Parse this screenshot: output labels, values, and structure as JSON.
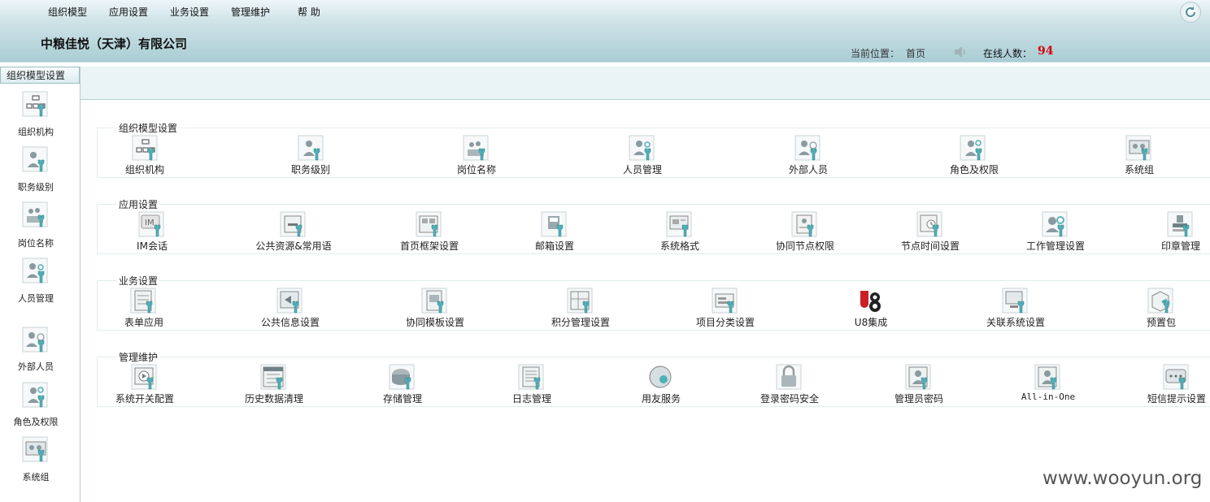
{
  "top_menu": [
    "组织模型",
    "应用设置",
    "业务设置",
    "管理维护",
    "帮 助"
  ],
  "company": "中粮佳悦（天津）有限公司",
  "location_label": "当前位置：",
  "location_value": "首页",
  "online_label": "在线人数：",
  "online_count": "94",
  "sidebar": {
    "title": "组织模型设置",
    "items": [
      {
        "label": "组织机构",
        "icon": "org-structure-icon"
      },
      {
        "label": "职务级别",
        "icon": "job-level-icon"
      },
      {
        "label": "岗位名称",
        "icon": "position-name-icon"
      },
      {
        "label": "人员管理",
        "icon": "personnel-icon"
      },
      {
        "label": "外部人员",
        "icon": "external-person-icon"
      },
      {
        "label": "角色及权限",
        "icon": "role-permission-icon"
      },
      {
        "label": "系统组",
        "icon": "system-group-icon"
      }
    ]
  },
  "sections": [
    {
      "title": "组织模型设置",
      "items": [
        {
          "label": "组织机构",
          "icon": "org-structure-icon"
        },
        {
          "label": "职务级别",
          "icon": "job-level-icon"
        },
        {
          "label": "岗位名称",
          "icon": "position-name-icon"
        },
        {
          "label": "人员管理",
          "icon": "personnel-icon"
        },
        {
          "label": "外部人员",
          "icon": "external-person-icon"
        },
        {
          "label": "角色及权限",
          "icon": "role-permission-icon"
        },
        {
          "label": "系统组",
          "icon": "system-group-icon"
        }
      ]
    },
    {
      "title": "应用设置",
      "items": [
        {
          "label": "IM会话",
          "icon": "im-chat-icon"
        },
        {
          "label": "公共资源&常用语",
          "icon": "public-resource-icon"
        },
        {
          "label": "首页框架设置",
          "icon": "homepage-frame-icon"
        },
        {
          "label": "邮箱设置",
          "icon": "mailbox-icon"
        },
        {
          "label": "系统格式",
          "icon": "system-format-icon"
        },
        {
          "label": "协同节点权限",
          "icon": "node-permission-icon"
        },
        {
          "label": "节点时间设置",
          "icon": "node-time-icon"
        },
        {
          "label": "工作管理设置",
          "icon": "work-management-icon"
        },
        {
          "label": "印章管理",
          "icon": "seal-icon"
        }
      ]
    },
    {
      "title": "业务设置",
      "items": [
        {
          "label": "表单应用",
          "icon": "form-app-icon"
        },
        {
          "label": "公共信息设置",
          "icon": "public-info-icon"
        },
        {
          "label": "协同模板设置",
          "icon": "template-icon"
        },
        {
          "label": "积分管理设置",
          "icon": "points-icon"
        },
        {
          "label": "项目分类设置",
          "icon": "project-category-icon"
        },
        {
          "label": "U8集成",
          "icon": "u8-logo-icon"
        },
        {
          "label": "关联系统设置",
          "icon": "linked-system-icon"
        },
        {
          "label": "预置包",
          "icon": "preset-package-icon"
        }
      ]
    },
    {
      "title": "管理维护",
      "items": [
        {
          "label": "系统开关配置",
          "icon": "system-switch-icon"
        },
        {
          "label": "历史数据清理",
          "icon": "history-cleanup-icon"
        },
        {
          "label": "存储管理",
          "icon": "storage-icon"
        },
        {
          "label": "日志管理",
          "icon": "log-icon"
        },
        {
          "label": "用友服务",
          "icon": "service-globe-icon"
        },
        {
          "label": "登录密码安全",
          "icon": "lock-icon"
        },
        {
          "label": "管理员密码",
          "icon": "admin-password-icon"
        },
        {
          "label": "All-in-One",
          "icon": "all-in-one-icon"
        },
        {
          "label": "短信提示设置",
          "icon": "sms-icon"
        }
      ]
    }
  ],
  "watermark": "www.wooyun.org",
  "colors": {
    "accent": "#4fb0b8",
    "online_count": "#d40000"
  }
}
